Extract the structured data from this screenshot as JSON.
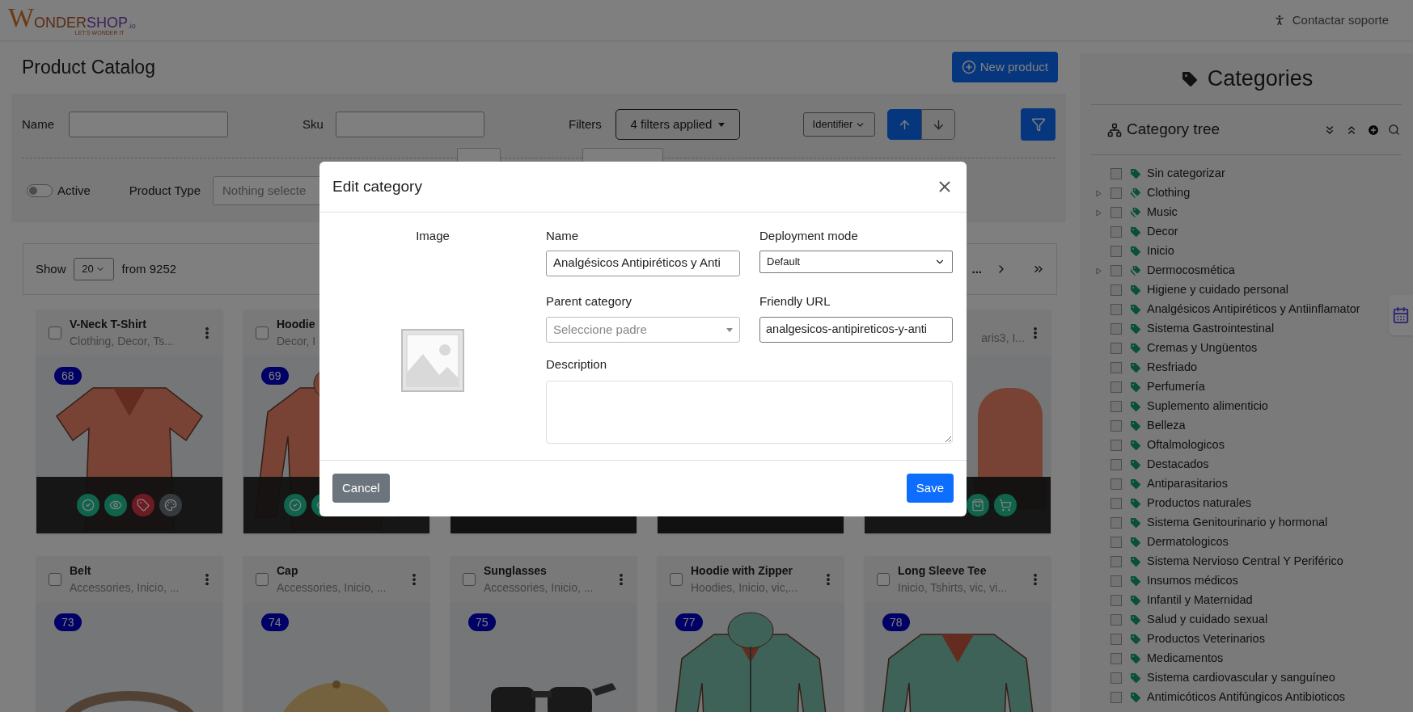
{
  "header": {
    "logo": {
      "mark": "W",
      "word_a": "ONDER",
      "word_b": "SHOP",
      "suffix": ".io",
      "tagline": "LET'S WONDER IT"
    },
    "support_link": "Contactar soporte"
  },
  "catalog": {
    "title": "Product Catalog",
    "new_button": "New product",
    "filters": {
      "name_label": "Name",
      "sku_label": "Sku",
      "filters_label": "Filters",
      "filters_button": "4 filters applied",
      "sort_field": "Identifier",
      "sort_buttons": [
        {
          "kind": "up",
          "selected": true
        },
        {
          "kind": "down",
          "selected": false
        }
      ],
      "active": {
        "label": "Active",
        "on": false
      },
      "product_type_label": "Product Type",
      "product_type_placeholder": "Nothing selecte"
    },
    "paging": {
      "show_label": "Show",
      "page_size": "20",
      "total": "from 9252",
      "ellipsis": "..."
    },
    "products": [
      {
        "kind": "product",
        "title": "V-Neck T-Shirt",
        "subtitle": "Clothing, Decor, Ts...",
        "badge": "68",
        "checked": false,
        "more_menu": true,
        "actions": [
          {
            "kind": "check"
          },
          {
            "kind": "eye"
          },
          {
            "kind": "tag"
          },
          {
            "kind": "palette"
          }
        ]
      },
      {
        "kind": "product",
        "title": "Hoodie",
        "subtitle": "Decor, I",
        "badge": "69",
        "checked": false,
        "more_menu": false,
        "actions": [
          {
            "kind": "check"
          },
          {
            "kind": "eye"
          }
        ]
      },
      {
        "kind": "covered"
      },
      {
        "kind": "covered"
      },
      {
        "kind": "product",
        "subtitle": "aris3, I...",
        "more_menu": true,
        "actions": [
          {
            "kind": "bag"
          },
          {
            "kind": "cart"
          }
        ]
      },
      {
        "kind": "product",
        "title": "Belt",
        "subtitle": "Accessories, Inicio, ...",
        "badge": "73",
        "checked": false,
        "more_menu": true
      },
      {
        "kind": "product",
        "title": "Cap",
        "subtitle": "Accessories, Inicio, ...",
        "badge": "74",
        "checked": false,
        "more_menu": true
      },
      {
        "kind": "product",
        "title": "Sunglasses",
        "subtitle": "Accessories, Inicio, ...",
        "badge": "75",
        "checked": false,
        "more_menu": true
      },
      {
        "kind": "product",
        "title": "Hoodie with Zipper",
        "subtitle": "Hoodies, Inicio, vic,...",
        "badge": "77",
        "checked": false,
        "more_menu": true
      },
      {
        "kind": "product",
        "title": "Long Sleeve Tee",
        "subtitle": "Inicio, Tshirts, vic, vi...",
        "badge": "78",
        "checked": false,
        "more_menu": true
      }
    ]
  },
  "categories": {
    "title": "Categories",
    "tree_title": "Category tree",
    "items": [
      {
        "label": "Sin categorizar",
        "kind": "leaf",
        "checked": false
      },
      {
        "label": "Clothing",
        "kind": "parent",
        "checked": false
      },
      {
        "label": "Music",
        "kind": "parent",
        "checked": false
      },
      {
        "label": "Decor",
        "kind": "leaf",
        "checked": false
      },
      {
        "label": "Inicio",
        "kind": "leaf",
        "checked": false
      },
      {
        "label": "Dermocosmética",
        "kind": "parent",
        "checked": false
      },
      {
        "label": "Higiene y cuidado personal",
        "kind": "leaf",
        "checked": false
      },
      {
        "label": "Analgésicos Antipiréticos y Antiinflamator",
        "kind": "leaf",
        "checked": false
      },
      {
        "label": "Sistema Gastrointestinal",
        "kind": "leaf",
        "checked": false
      },
      {
        "label": "Cremas y Ungüentos",
        "kind": "leaf",
        "checked": false
      },
      {
        "label": "Resfriado",
        "kind": "leaf",
        "checked": false
      },
      {
        "label": "Perfumería",
        "kind": "leaf",
        "checked": false
      },
      {
        "label": "Suplemento alimenticio",
        "kind": "leaf",
        "checked": false
      },
      {
        "label": "Belleza",
        "kind": "leaf",
        "checked": false
      },
      {
        "label": "Oftalmologicos",
        "kind": "leaf",
        "checked": false
      },
      {
        "label": "Destacados",
        "kind": "leaf",
        "checked": false
      },
      {
        "label": "Antiparasitarios",
        "kind": "leaf",
        "checked": false
      },
      {
        "label": "Productos naturales",
        "kind": "leaf",
        "checked": false
      },
      {
        "label": "Sistema Genitourinario y hormonal",
        "kind": "leaf",
        "checked": false
      },
      {
        "label": "Dermatologicos",
        "kind": "leaf",
        "checked": false
      },
      {
        "label": "Sistema Nervioso Central Y Periférico",
        "kind": "leaf",
        "checked": false
      },
      {
        "label": "Insumos médicos",
        "kind": "leaf",
        "checked": false
      },
      {
        "label": "Infantil y Maternidad",
        "kind": "leaf",
        "checked": false
      },
      {
        "label": "Salud y cuidado sexual",
        "kind": "leaf",
        "checked": false
      },
      {
        "label": "Productos Veterinarios",
        "kind": "leaf",
        "checked": false
      },
      {
        "label": "Medicamentos",
        "kind": "leaf",
        "checked": false
      },
      {
        "label": "Sistema cardiovascular y sanguíneo",
        "kind": "leaf",
        "checked": false
      },
      {
        "label": "Antimicóticos Antifúngicos Antibioticos",
        "kind": "leaf",
        "checked": false
      }
    ]
  },
  "modal": {
    "title": "Edit category",
    "image_label": "Image",
    "name_label": "Name",
    "name_value": "Analgésicos Antipiréticos y Anti",
    "mode_label": "Deployment mode",
    "mode_value": "Default",
    "parent_label": "Parent category",
    "parent_placeholder": "Seleccione padre",
    "url_label": "Friendly URL",
    "url_value": "analgesicos-antipireticos-y-anti",
    "description_label": "Description",
    "cancel": "Cancel",
    "save": "Save"
  }
}
